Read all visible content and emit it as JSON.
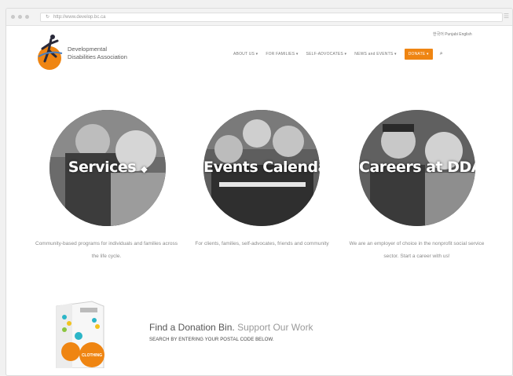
{
  "browser": {
    "url": "http://www.develop.bc.ca",
    "reload_icon": "reload-icon",
    "menu_icon": "hamburger-icon"
  },
  "header": {
    "logo_line1": "Developmental",
    "logo_line2": "Disabilities Association",
    "languages": "한국어 Punjabi English",
    "nav": [
      {
        "label": "ABOUT US ▾"
      },
      {
        "label": "FOR FAMILIES ▾"
      },
      {
        "label": "SELF-ADVOCATES ▾"
      },
      {
        "label": "NEWS and EVENTS ▾"
      }
    ],
    "donate_label": "DONATE ▾",
    "search_icon": "search-icon",
    "accent_color": "#ef8512"
  },
  "features": [
    {
      "title": "Services",
      "description": "Community-based programs for individuals and families across the life cycle."
    },
    {
      "title": "Events Calendar",
      "description": "For clients, families, self-advocates, friends and community"
    },
    {
      "title": "Careers at DDA",
      "description": "We are an employer of choice in the nonprofit social service sector. Start a career with us!"
    }
  ],
  "donation": {
    "title_main": "Find a Donation Bin.",
    "title_light": "Support Our Work",
    "subtitle": "SEARCH BY ENTERING YOUR POSTAL CODE BELOW.",
    "bin_label": "CLOTHING"
  }
}
